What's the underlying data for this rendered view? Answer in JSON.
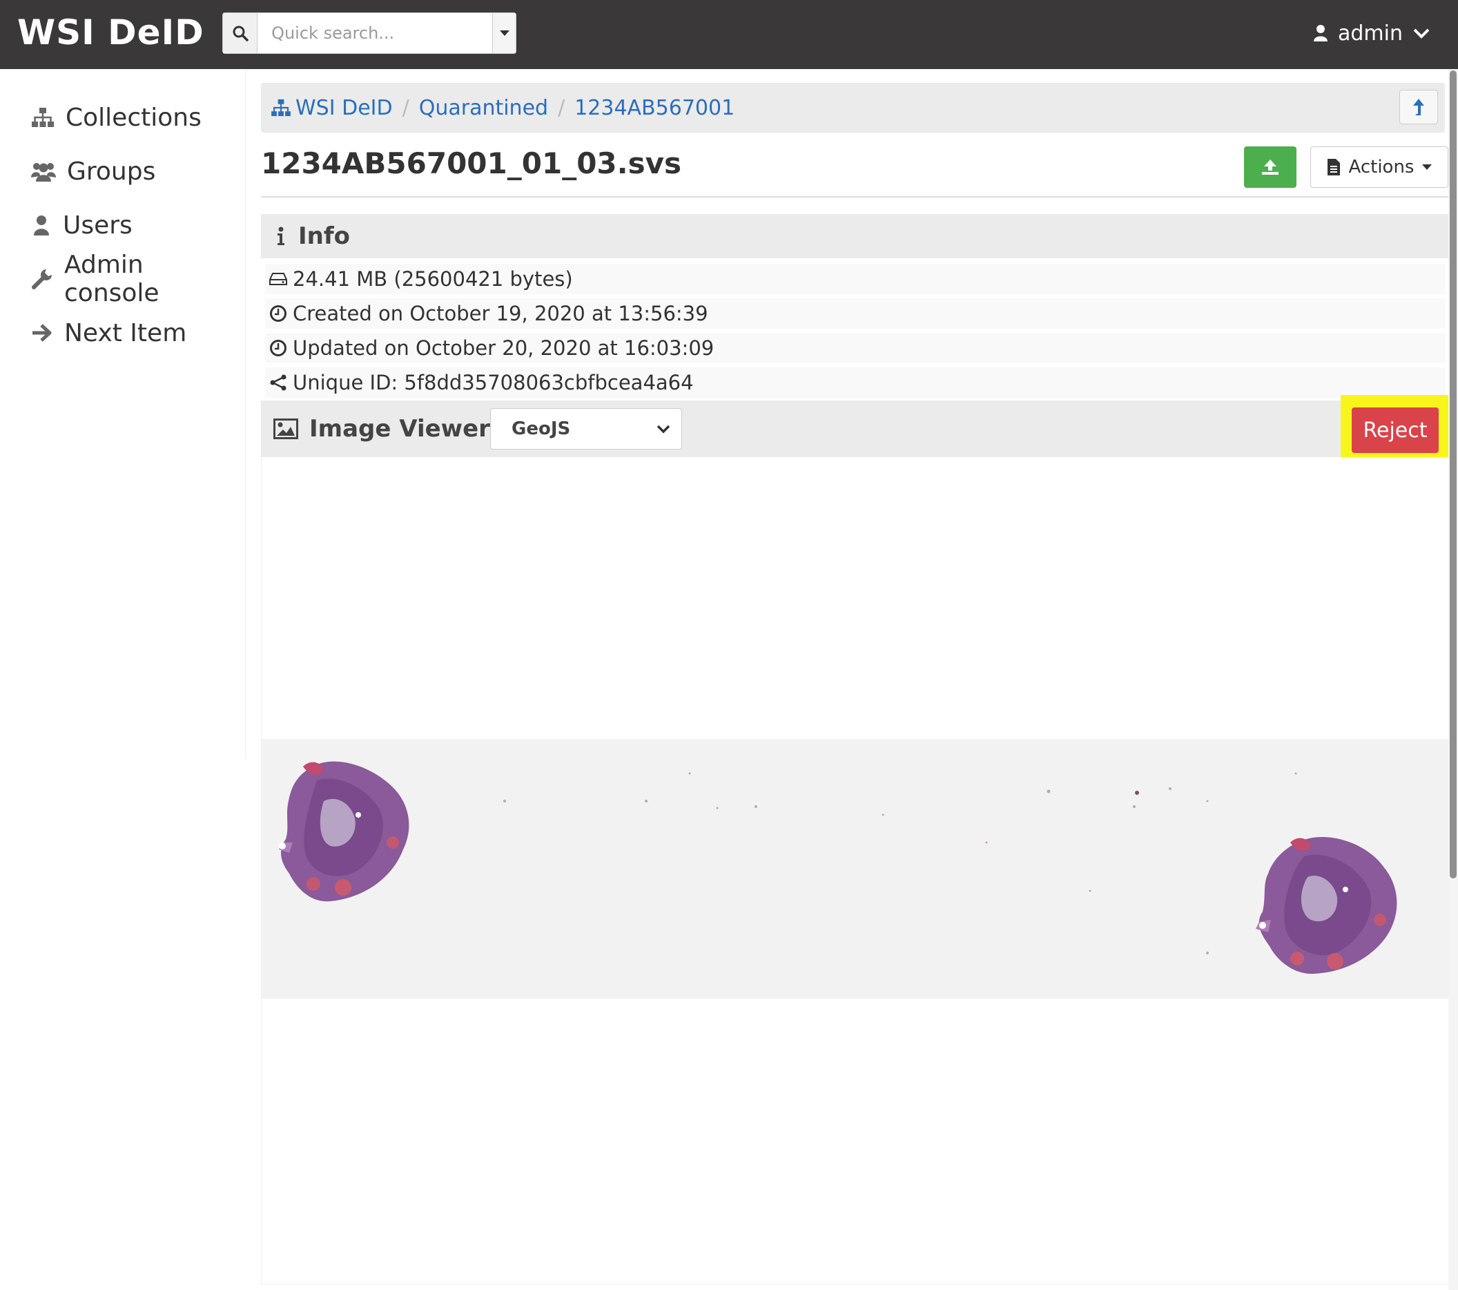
{
  "app": {
    "brand": "WSI DeID",
    "user": "admin"
  },
  "search": {
    "placeholder": "Quick search..."
  },
  "sidebar": {
    "items": [
      {
        "label": "Collections",
        "icon": "sitemap-icon"
      },
      {
        "label": "Groups",
        "icon": "users-icon"
      },
      {
        "label": "Users",
        "icon": "user-icon"
      },
      {
        "label": "Admin console",
        "icon": "wrench-icon"
      },
      {
        "label": "Next Item",
        "icon": "arrow-right-icon"
      }
    ]
  },
  "breadcrumb": {
    "items": [
      "WSI DeID",
      "Quarantined",
      "1234AB567001"
    ],
    "separator": "/"
  },
  "item": {
    "title": "1234AB567001_01_03.svs",
    "actions_label": "Actions"
  },
  "info": {
    "heading": "Info",
    "size": "24.41 MB (25600421 bytes)",
    "created": "Created on October 19, 2020 at 13:56:39",
    "updated": "Updated on October 20, 2020 at 16:03:09",
    "unique_id": "Unique ID: 5f8dd35708063cbfbcea4a64"
  },
  "viewer": {
    "heading": "Image Viewer",
    "selected": "GeoJS",
    "reject_label": "Reject"
  },
  "colors": {
    "navbar": "#3a3838",
    "link": "#2a6ebb",
    "success": "#4cae4c",
    "danger": "#d9434a",
    "highlight": "#f7f61a"
  }
}
